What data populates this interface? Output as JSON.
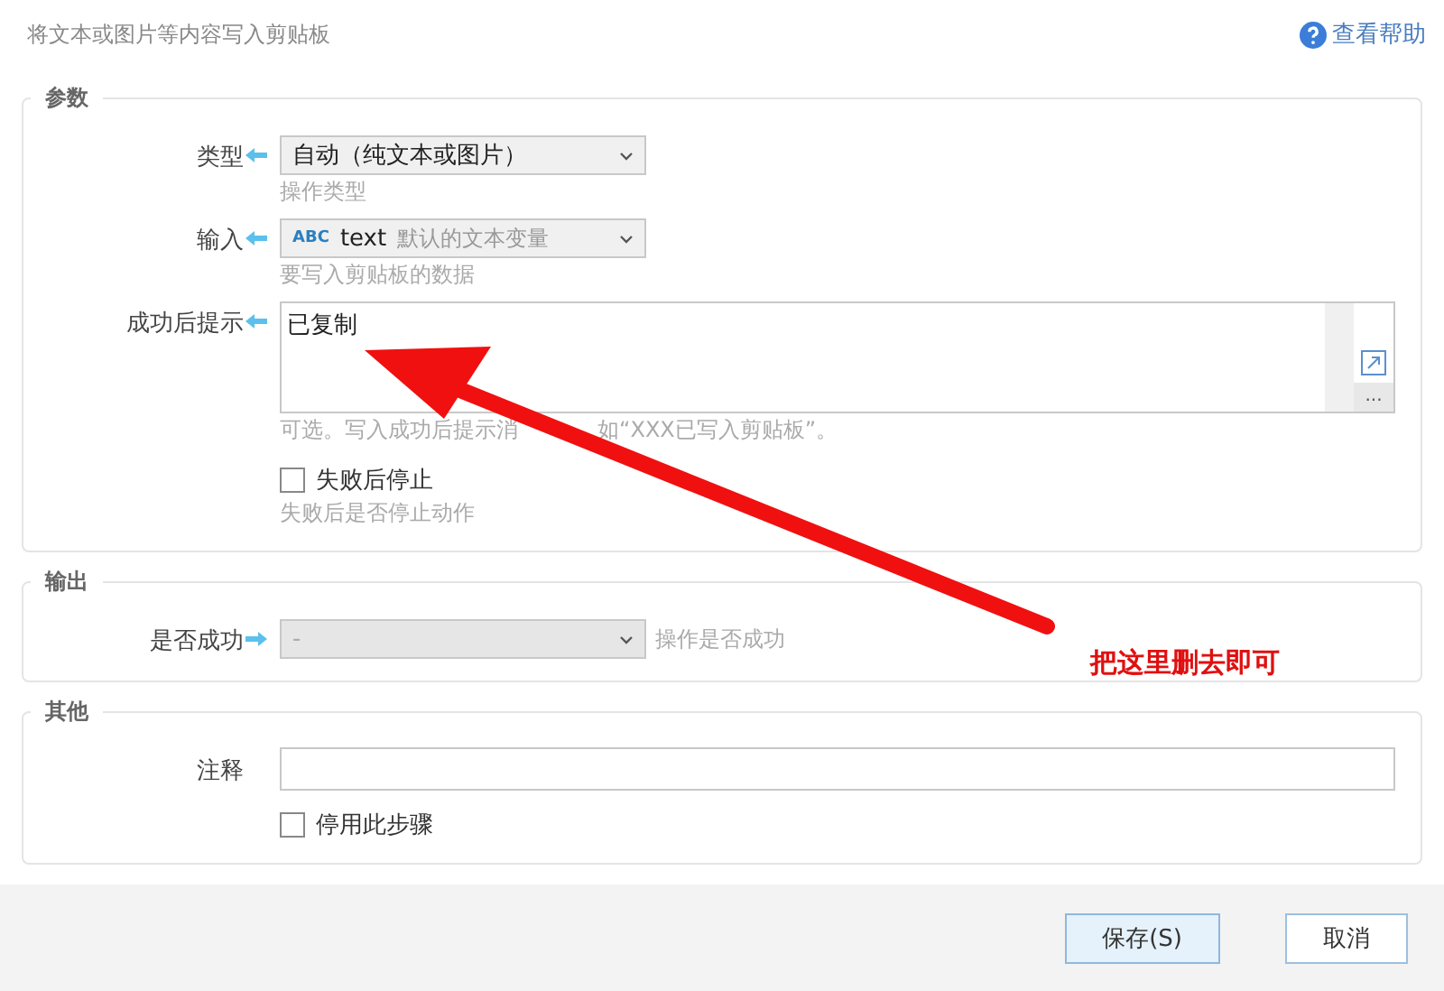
{
  "header": {
    "title": "将文本或图片等内容写入剪贴板",
    "help_link": "查看帮助"
  },
  "sections": [
    {
      "title": "参数",
      "rows": [
        {
          "kind": "select",
          "label": "类型",
          "output": false,
          "value": "自动（纯文本或图片）",
          "hint": "操作类型"
        },
        {
          "kind": "variable",
          "label": "输入",
          "output": false,
          "badge": "ABC",
          "value": "text",
          "note": "默认的文本变量",
          "hint": "要写入剪贴板的数据"
        },
        {
          "kind": "textarea",
          "label": "成功后提示",
          "output": false,
          "value": "已复制",
          "more_button": "...",
          "hint": "可选。写入成功后提示消",
          "hint_tail": "如“XXX已写入剪贴板”。"
        },
        {
          "kind": "checkbox",
          "label": "失败后停止",
          "checked": false,
          "hint": "失败后是否停止动作"
        }
      ]
    },
    {
      "title": "输出",
      "rows": [
        {
          "kind": "select",
          "label": "是否成功",
          "output": true,
          "value": "-",
          "disabled": true,
          "side_hint": "操作是否成功"
        }
      ]
    },
    {
      "title": "其他",
      "rows": [
        {
          "kind": "text",
          "label": "注释"
        },
        {
          "kind": "checkbox",
          "label": "停用此步骤",
          "checked": false
        }
      ]
    }
  ],
  "annotation": {
    "text": "把这里删去即可"
  },
  "buttons": [
    {
      "label": "保存(S)",
      "primary": true
    },
    {
      "label": "取消",
      "primary": false
    }
  ]
}
